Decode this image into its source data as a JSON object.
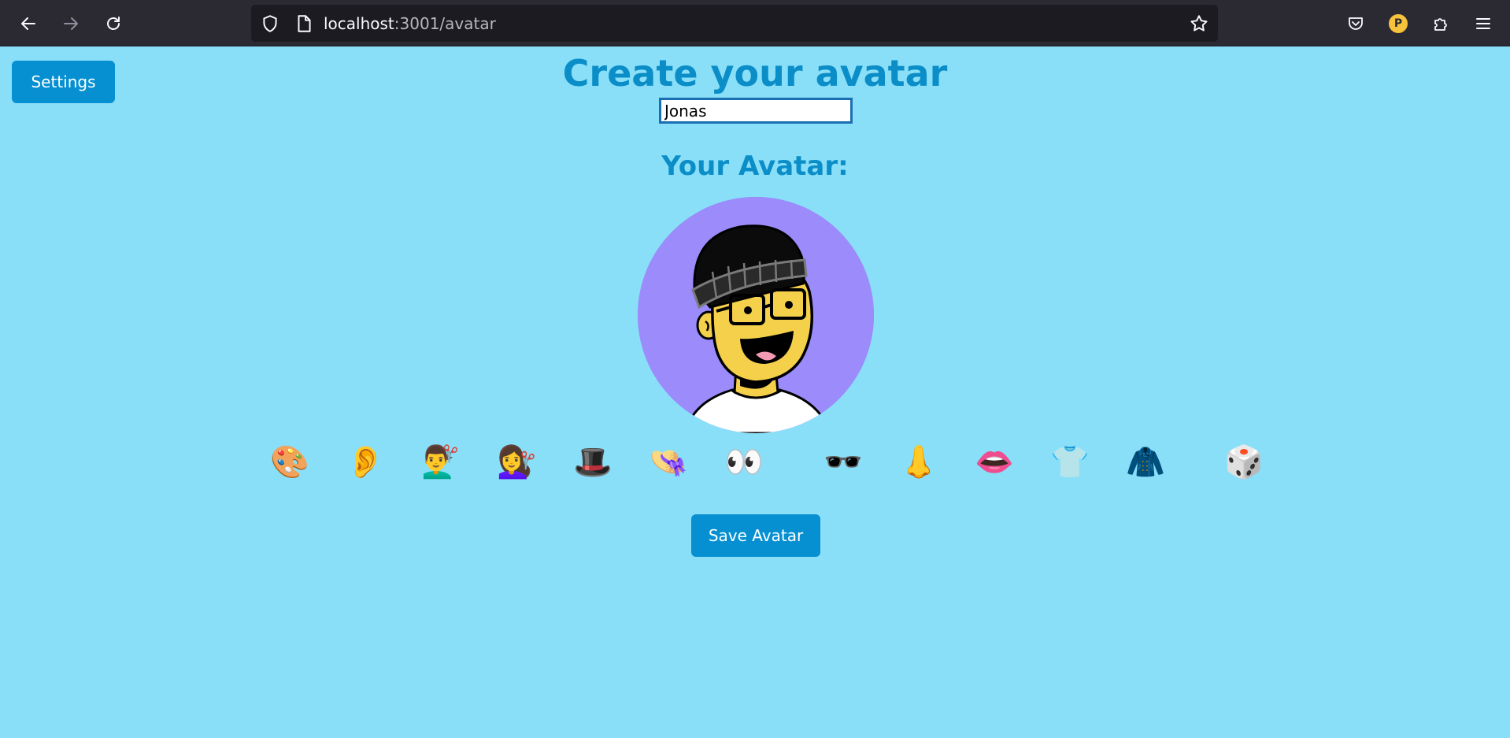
{
  "browser": {
    "url_host": "localhost",
    "url_path": ":3001/avatar",
    "profile_initial": "P"
  },
  "page": {
    "settings_label": "Settings",
    "title": "Create your avatar",
    "name_value": "Jonas",
    "avatar_heading": "Your Avatar:",
    "save_label": "Save Avatar"
  },
  "options": [
    {
      "name": "palette-icon",
      "glyph": "🎨"
    },
    {
      "name": "ear-icon",
      "glyph": "👂"
    },
    {
      "name": "man-haircut-icon",
      "glyph": "💇‍♂️"
    },
    {
      "name": "woman-haircut-icon",
      "glyph": "💇‍♀️"
    },
    {
      "name": "top-hat-icon",
      "glyph": "🎩"
    },
    {
      "name": "womans-hat-icon",
      "glyph": "👒"
    },
    {
      "name": "eyes-icon",
      "glyph": "👀"
    },
    {
      "name": "sunglasses-icon",
      "glyph": "🕶️"
    },
    {
      "name": "nose-icon",
      "glyph": "👃"
    },
    {
      "name": "mouth-icon",
      "glyph": "👄"
    },
    {
      "name": "tshirt-icon",
      "glyph": "👕"
    },
    {
      "name": "coat-icon",
      "glyph": "🧥"
    },
    {
      "name": "dice-icon",
      "glyph": "🎲"
    }
  ],
  "colors": {
    "page_bg": "#8adff8",
    "accent": "#0690d2",
    "heading": "#0b8ec8",
    "avatar_bg": "#9b8bfb"
  }
}
